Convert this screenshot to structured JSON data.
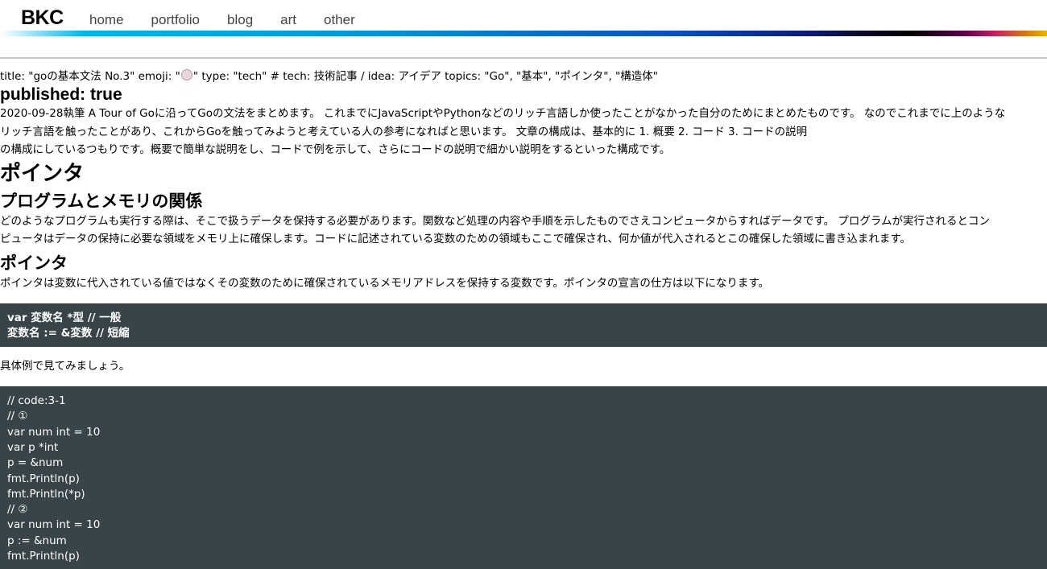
{
  "header": {
    "brand": "BKC",
    "nav": [
      "home",
      "portfolio",
      "blog",
      "art",
      "other"
    ]
  },
  "frontmatter": {
    "prefix": "title: \"goの基本文法 No.3\" emoji: \"",
    "emoji_icon": "mouse-face-emoji",
    "suffix": "\" type: \"tech\" # tech: 技術記事 / idea: アイデア topics: \"Go\", \"基本\", \"ポインタ\", \"構造体\""
  },
  "published": "published: true",
  "intro": [
    "2020-09-28執筆 A Tour of Goに沿ってGoの文法をまとめます。 これまでにJavaScriptやPythonなどのリッチ言語しか使ったことがなかった自分のためにまとめたものです。 なのでこれまでに上のような",
    "リッチ言語を触ったことがあり、これからGoを触ってみようと考えている人の参考になればと思います。 文章の構成は、基本的に 1. 概要 2. コード 3. コードの説明",
    "の構成にしているつもりです。概要で簡単な説明をし、コードで例を示して、さらにコードの説明で細かい説明をするといった構成です。"
  ],
  "h1": "ポインタ",
  "section1": {
    "heading": "プログラムとメモリの関係",
    "lines": [
      "どのようなプログラムも実行する際は、そこで扱うデータを保持する必要があります。関数など処理の内容や手順を示したものでさえコンピュータからすればデータです。 プログラムが実行されるとコン",
      "ピュータはデータの保持に必要な領域をメモリ上に確保します。コードに記述されている変数のための領域もここで確保され、何か値が代入されるとこの確保した領域に書き込まれます。"
    ]
  },
  "section2": {
    "heading": "ポインタ",
    "text": "ポインタは変数に代入されている値ではなくその変数のために確保されているメモリアドレスを保持する変数です。ポインタの宣言の仕方は以下になります。",
    "code1": [
      "var 変数名 *型 // 一般",
      "変数名 := &変数 // 短縮"
    ],
    "after": "具体例で見てみましょう。",
    "code2": [
      "// code:3-1",
      "// ①",
      "var num int = 10",
      "var p *int",
      "p = &num",
      "fmt.Println(p)",
      "fmt.Println(*p)",
      "// ②",
      "var num int = 10",
      "p := &num",
      "fmt.Println(p)"
    ]
  }
}
